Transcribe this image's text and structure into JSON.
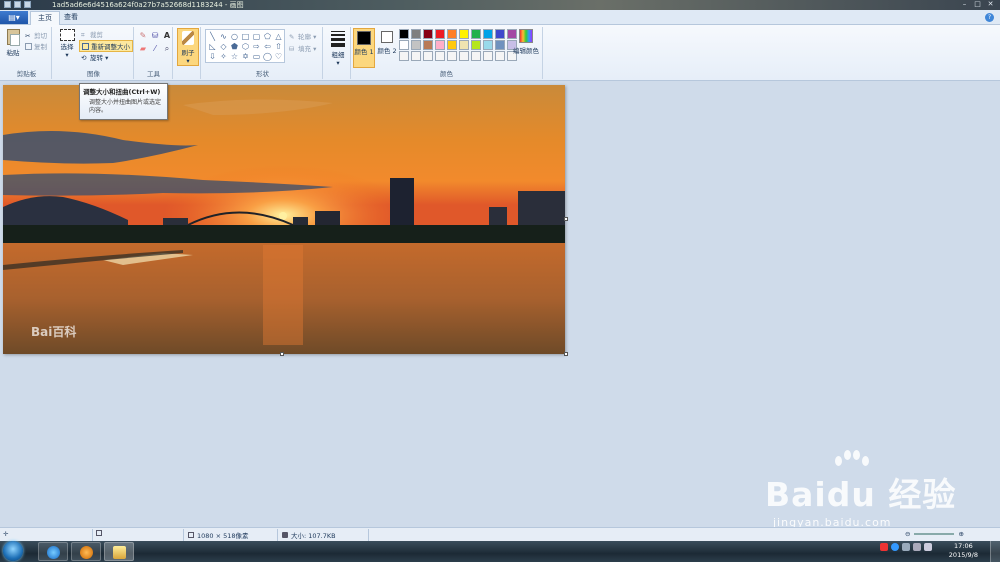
{
  "window": {
    "title": "1ad5ad6e6d4516a624f0a27b7a52668d1183244 - 画图"
  },
  "tabs": {
    "file_label": "▤▾",
    "home_label": "主页",
    "view_label": "查看"
  },
  "ribbon": {
    "clipboard": {
      "group_label": "剪贴板",
      "paste_label": "粘贴",
      "cut_label": "剪切",
      "copy_label": "复制"
    },
    "image": {
      "group_label": "图像",
      "select_label": "选择",
      "crop_label": "裁剪",
      "resize_label": "重新调整大小",
      "rotate_label": "旋转 ▾"
    },
    "tools": {
      "group_label": "工具"
    },
    "brushes": {
      "label": "刷子"
    },
    "shapes": {
      "group_label": "形状",
      "outline_label": "轮廓 ▾",
      "fill_label": "填充 ▾"
    },
    "size": {
      "label": "粗细"
    },
    "colors": {
      "group_label": "颜色",
      "color1_label": "颜色 1",
      "color2_label": "颜色 2",
      "color1": "#000000",
      "color2": "#ffffff",
      "edit_label": "编辑颜色",
      "palette": [
        "#000000",
        "#7f7f7f",
        "#880015",
        "#ed1c24",
        "#ff7f27",
        "#fff200",
        "#22b14c",
        "#00a2e8",
        "#3f48cc",
        "#a349a4",
        "#ffffff",
        "#c3c3c3",
        "#b97a57",
        "#ffaec9",
        "#ffc90e",
        "#efe4b0",
        "#b5e61d",
        "#99d9ea",
        "#7092be",
        "#c8bfe7",
        "#f5f5f5",
        "#f5f5f5",
        "#f5f5f5",
        "#f5f5f5",
        "#f5f5f5",
        "#f5f5f5",
        "#f5f5f5",
        "#f5f5f5",
        "#f5f5f5",
        "#f5f5f5"
      ]
    }
  },
  "tooltip": {
    "title": "调整大小和扭曲(Ctrl+W)",
    "description": "调整大小并扭曲图片或选定内容。"
  },
  "canvas": {
    "watermark_text": "Bai百科"
  },
  "statusbar": {
    "dimensions": "1080 × 518像素",
    "size": "大小: 107.7KB"
  },
  "watermark": {
    "brand": "Baidu 经验",
    "url": "jingyan.baidu.com"
  },
  "taskbar": {
    "time": "17:06",
    "date": "2015/9/8"
  }
}
